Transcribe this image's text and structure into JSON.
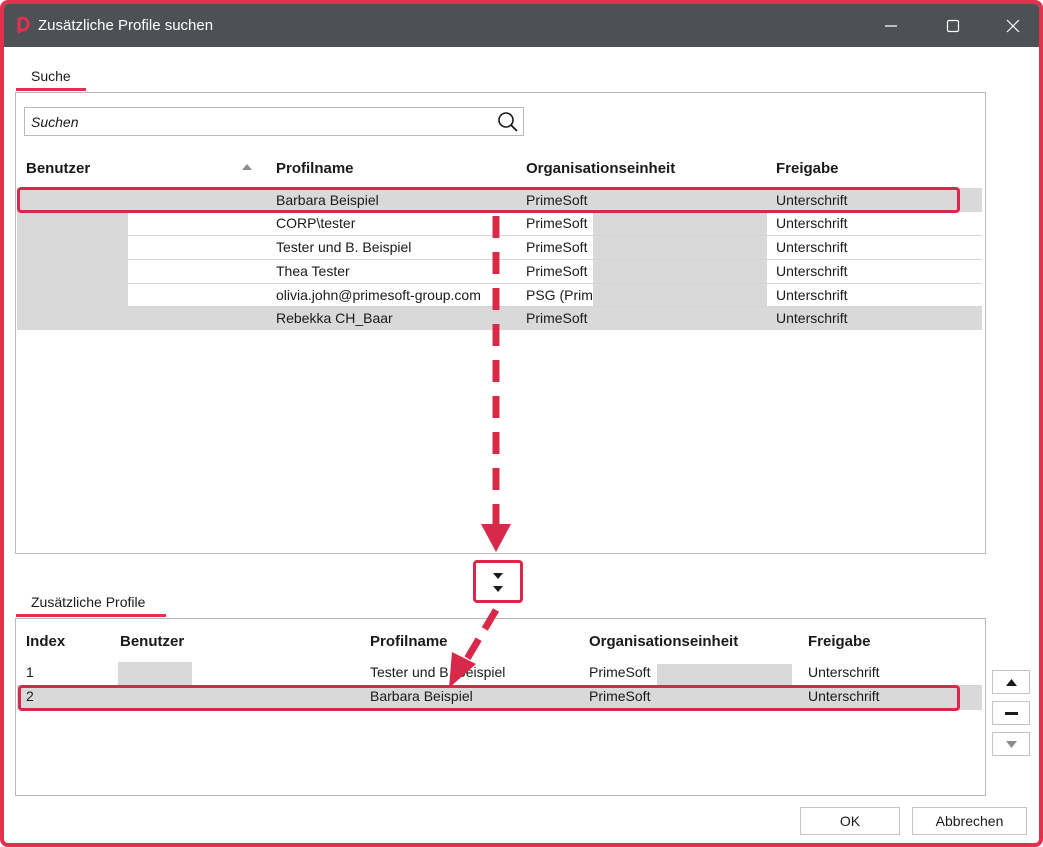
{
  "window": {
    "title": "Zusätzliche Profile suchen",
    "accent_color": "#e0314f",
    "titlebar_color": "#4d5156",
    "icons": [
      "primesoft-logo-icon",
      "minimize-icon",
      "maximize-icon",
      "close-icon"
    ]
  },
  "search_tab": {
    "label": "Suche"
  },
  "search": {
    "placeholder": "Suchen",
    "value": "",
    "icon": "search-icon"
  },
  "search_table": {
    "columns": [
      "Benutzer",
      "Profilname",
      "Organisationseinheit",
      "Freigabe"
    ],
    "sort_column": "Benutzer",
    "sort_icon": "sort-ascending-icon",
    "rows": [
      {
        "benutzer": "",
        "profilname": "Barbara Beispiel",
        "org": "PrimeSoft",
        "freigabe": "Unterschrift",
        "selected": true
      },
      {
        "benutzer": "",
        "profilname": "CORP\\tester",
        "org": "PrimeSoft",
        "freigabe": "Unterschrift",
        "selected": false
      },
      {
        "benutzer": "",
        "profilname": "Tester und B. Beispiel",
        "org": "PrimeSoft",
        "freigabe": "Unterschrift",
        "selected": false
      },
      {
        "benutzer": "",
        "profilname": "Thea Tester",
        "org": "PrimeSoft",
        "freigabe": "Unterschrift",
        "selected": false
      },
      {
        "benutzer": "",
        "profilname": "olivia.john@primesoft-group.com",
        "org": "PSG (Prime",
        "freigabe": "Unterschrift",
        "selected": false
      },
      {
        "benutzer": "",
        "profilname": "Rebekka CH_Baar",
        "org": "PrimeSoft",
        "freigabe": "Unterschrift",
        "selected": false
      }
    ]
  },
  "move_down_button": {
    "icon": "move-down-icon"
  },
  "profiles_tab": {
    "label": "Zusätzliche Profile"
  },
  "profiles_table": {
    "columns": [
      "Index",
      "Benutzer",
      "Profilname",
      "Organisationseinheit",
      "Freigabe"
    ],
    "rows": [
      {
        "index": "1",
        "benutzer": "",
        "profilname": "Tester und B. Beispiel",
        "org": "PrimeSoft",
        "freigabe": "Unterschrift",
        "selected": false
      },
      {
        "index": "2",
        "benutzer": "",
        "profilname": "Barbara Beispiel",
        "org": "PrimeSoft",
        "freigabe": "Unterschrift",
        "selected": true
      }
    ]
  },
  "side_buttons": [
    "move-up-icon",
    "remove-icon",
    "move-down-small-icon"
  ],
  "footer": {
    "ok_label": "OK",
    "cancel_label": "Abbrechen"
  }
}
